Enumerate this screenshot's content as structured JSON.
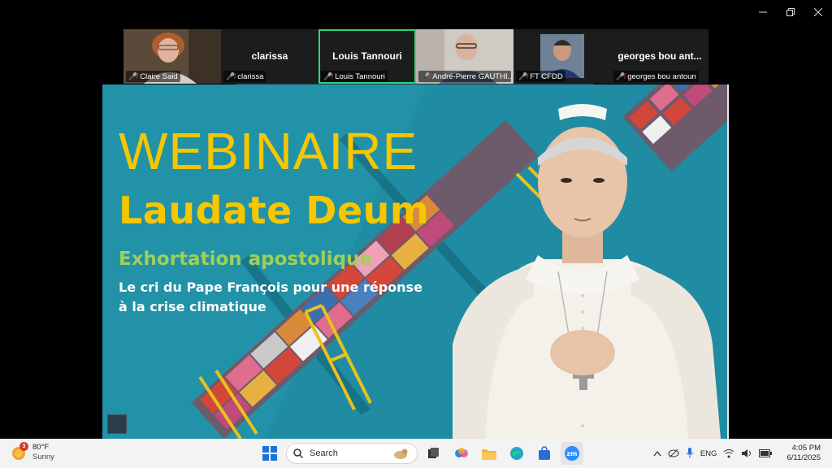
{
  "window": {
    "controls": {
      "minimize": "–",
      "restore": "❐",
      "close": "✕"
    }
  },
  "participants": [
    {
      "name": "Claire Said",
      "center": "",
      "muted": true,
      "video": true
    },
    {
      "name": "clarissa",
      "center": "clarissa",
      "muted": true,
      "video": false
    },
    {
      "name": "Louis Tannouri",
      "center": "Louis Tannouri",
      "muted": true,
      "video": false,
      "active": true
    },
    {
      "name": "André-Pierre GAUTHI...",
      "center": "",
      "muted": true,
      "video": true
    },
    {
      "name": "FT CFDD",
      "center": "",
      "muted": true,
      "video": true
    },
    {
      "name": "georges bou antoun",
      "center": "georges bou ant...",
      "muted": true,
      "video": false
    }
  ],
  "slide": {
    "title1": "WEBINAIRE",
    "title2": "Laudate Deum",
    "subtitle": "Exhortation apostolique",
    "line1": "Le cri du Pape François pour une réponse",
    "line2": "à la crise climatique"
  },
  "taskbar": {
    "weather": {
      "temp": "80°F",
      "condition": "Sunny",
      "badge": "3"
    },
    "search_placeholder": "Search",
    "language": "ENG",
    "time": "4:05 PM",
    "date": "6/11/2025"
  },
  "colors": {
    "accent_active": "#2fd37a",
    "slide_yellow": "#f6c600",
    "slide_green": "#9ed05a",
    "mic_off": "#e0453a"
  }
}
